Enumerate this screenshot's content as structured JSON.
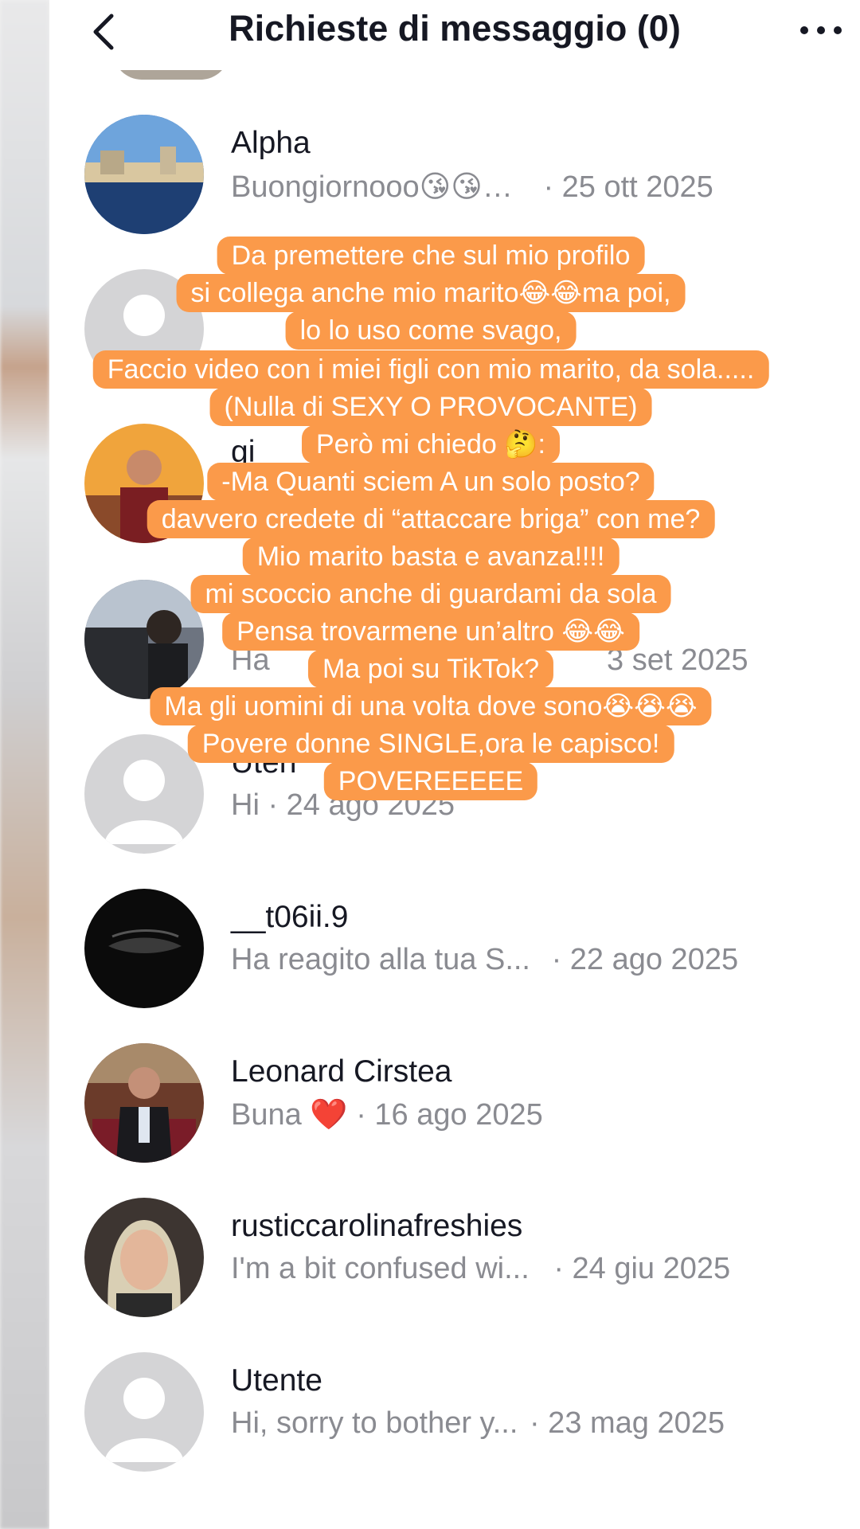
{
  "header": {
    "title": "Richieste di messaggio (0)"
  },
  "requests": [
    {
      "name": "Alpha",
      "preview": "Buongiornooo😘😘…",
      "date": "· 25 ott 2025"
    },
    {
      "name": "",
      "preview": "",
      "date": ""
    },
    {
      "name": "gi",
      "preview": "",
      "date": ""
    },
    {
      "name": "",
      "preview": "Ha",
      "date": "3 set 2025"
    },
    {
      "name": "Uten",
      "preview": "Hi · 24 ago 2025",
      "date": ""
    },
    {
      "name": "__t06ii.9",
      "preview": "Ha reagito alla tua S...",
      "date": "· 22 ago 2025"
    },
    {
      "name": "Leonard Cirstea",
      "preview": "Buna",
      "heart": "❤️",
      "date": "· 16 ago 2025"
    },
    {
      "name": "rusticcarolinafreshies",
      "preview": "I'm a bit confused wi...",
      "date": "· 24 giu 2025"
    },
    {
      "name": "Utente",
      "preview": "Hi, sorry to bother y...",
      "date": "· 23 mag 2025"
    }
  ],
  "overlay_text": [
    "Da premettere che sul mio profilo",
    "si collega anche mio marito😂😂ma poi,",
    "lo lo uso come svago,",
    "Faccio video con i miei figli con mio marito, da sola.....",
    "(Nulla di SEXY O PROVOCANTE)",
    "Però mi chiedo 🤔:",
    "-Ma Quanti sciem A un solo posto?",
    "davvero credete di “attaccare briga” con me?",
    "Mio marito basta e avanza!!!!",
    "mi scoccio anche di guardami da sola",
    "Pensa trovarmene un’altro 😂😂",
    "Ma poi su TikTok?",
    "Ma gli uomini di una volta dove sono😭😭😭",
    "Povere donne SINGLE,ora le capisco!",
    "POVEREEEEE"
  ],
  "colors": {
    "overlay_bg": "#fb9a4a",
    "primary_text": "#161823",
    "secondary_text": "#8a8b91",
    "background": "#ffffff"
  },
  "icons": {
    "back": "chevron-left-icon",
    "more": "more-horizontal-icon"
  }
}
